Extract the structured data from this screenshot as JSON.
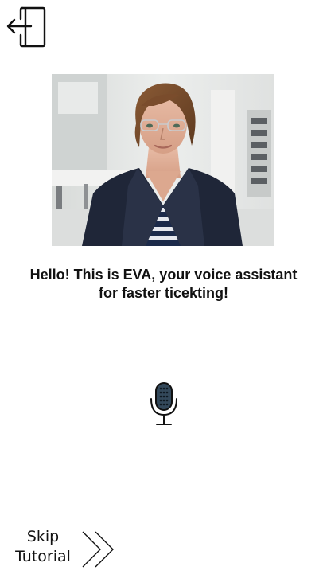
{
  "header": {
    "exit_icon": "logout-arrow-icon"
  },
  "assistant": {
    "avatar": "assistant-avatar-image",
    "greeting": "Hello! This is EVA, your voice assistant for faster ticekting!"
  },
  "voice": {
    "mic_icon": "microphone-icon"
  },
  "footer": {
    "skip_line1": "Skip",
    "skip_line2": "Tutorial",
    "skip_icon": "double-chevron-right-icon"
  }
}
